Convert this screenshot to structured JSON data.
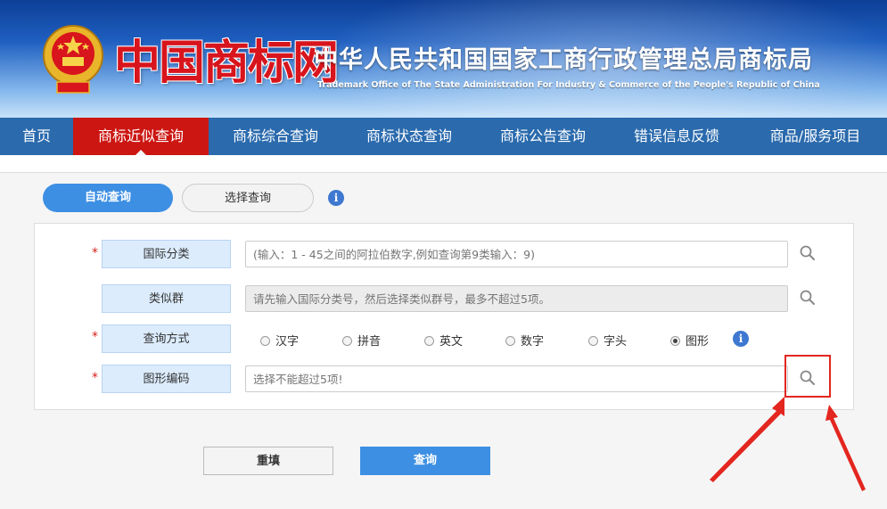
{
  "header": {
    "brand": "中国商标网",
    "office_cn": "中华人民共和国国家工商行政管理总局商标局",
    "office_en": "Trademark Office of The State Administration For Industry & Commerce of the People's Republic of China"
  },
  "nav": {
    "items": [
      {
        "label": "首页"
      },
      {
        "label": "商标近似查询",
        "active": true
      },
      {
        "label": "商标综合查询"
      },
      {
        "label": "商标状态查询"
      },
      {
        "label": "商标公告查询"
      },
      {
        "label": "错误信息反馈"
      },
      {
        "label": "商品/服务项目"
      }
    ]
  },
  "tabs": {
    "auto": "自动查询",
    "select": "选择查询"
  },
  "form": {
    "intl_class": {
      "label": "国际分类",
      "placeholder": "(输入：1 - 45之间的阿拉伯数字,例如查询第9类输入：9)"
    },
    "similar_group": {
      "label": "类似群",
      "placeholder": "请先输入国际分类号，然后选择类似群号，最多不超过5项。"
    },
    "query_method": {
      "label": "查询方式",
      "options": [
        "汉字",
        "拼音",
        "英文",
        "数字",
        "字头",
        "图形"
      ],
      "selected": "图形"
    },
    "figure_code": {
      "label": "图形编码",
      "placeholder": "选择不能超过5项!"
    }
  },
  "buttons": {
    "reset": "重填",
    "query": "查询"
  },
  "colors": {
    "nav_bg": "#2a6aad",
    "nav_active": "#cc1612",
    "primary": "#3d8fe3",
    "annotation": "#e3261f"
  }
}
